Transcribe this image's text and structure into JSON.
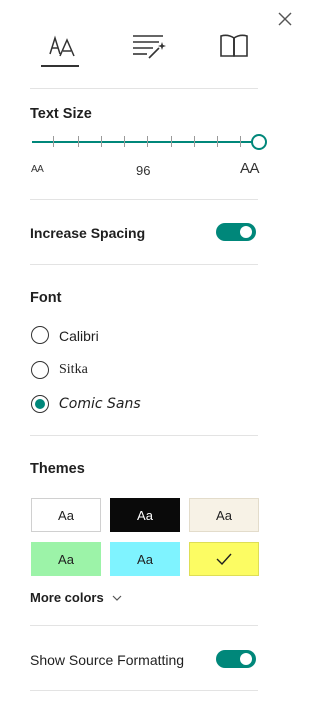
{
  "panel": {
    "close_icon": "close-icon",
    "tabs": [
      {
        "id": "text-preferences",
        "icon": "text-size-icon",
        "selected": true
      },
      {
        "id": "grammar-tools",
        "icon": "grammar-wand-icon",
        "selected": false
      },
      {
        "id": "reading-preferences",
        "icon": "book-icon",
        "selected": false
      }
    ]
  },
  "text_size": {
    "title": "Text Size",
    "value": "96",
    "small_glyph": "AA",
    "large_glyph": "AA",
    "accent": "#00877a"
  },
  "spacing": {
    "label": "Increase Spacing",
    "enabled": true
  },
  "font": {
    "title": "Font",
    "options": [
      {
        "label": "Calibri",
        "selected": false
      },
      {
        "label": "Sitka",
        "selected": false
      },
      {
        "label": "Comic Sans",
        "selected": true
      }
    ]
  },
  "themes": {
    "title": "Themes",
    "swatches": [
      {
        "label": "Aa",
        "bg": "#ffffff",
        "fg": "#1f1f1f",
        "selected": false
      },
      {
        "label": "Aa",
        "bg": "#0a0a0a",
        "fg": "#ffffff",
        "selected": false
      },
      {
        "label": "Aa",
        "bg": "#f7f2e6",
        "fg": "#1f1f1f",
        "selected": false
      },
      {
        "label": "Aa",
        "bg": "#9cf3a8",
        "fg": "#1f1f1f",
        "selected": false
      },
      {
        "label": "Aa",
        "bg": "#7ff3ff",
        "fg": "#1f1f1f",
        "selected": false
      },
      {
        "label": "",
        "bg": "#fcfc63",
        "fg": "#1f1f1f",
        "selected": true
      }
    ],
    "more_colors": "More colors"
  },
  "source_formatting": {
    "label": "Show Source Formatting",
    "enabled": true
  }
}
